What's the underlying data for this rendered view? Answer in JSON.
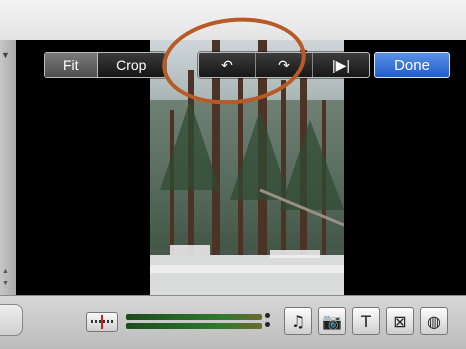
{
  "toolbar": {
    "fit_label": "Fit",
    "crop_label": "Crop",
    "rotate_left_icon": "↶",
    "rotate_right_icon": "↷",
    "play_icon": "|▶|",
    "done_label": "Done"
  },
  "bottom": {
    "tools": [
      {
        "name": "music-icon",
        "glyph": "♫"
      },
      {
        "name": "camera-icon",
        "glyph": "📷"
      },
      {
        "name": "title-icon",
        "glyph": "T"
      },
      {
        "name": "transition-icon",
        "glyph": "⊠"
      },
      {
        "name": "globe-icon",
        "glyph": "◍"
      }
    ]
  },
  "colors": {
    "highlight_ring": "#b85a26",
    "done_button": "#2a6ad8"
  }
}
